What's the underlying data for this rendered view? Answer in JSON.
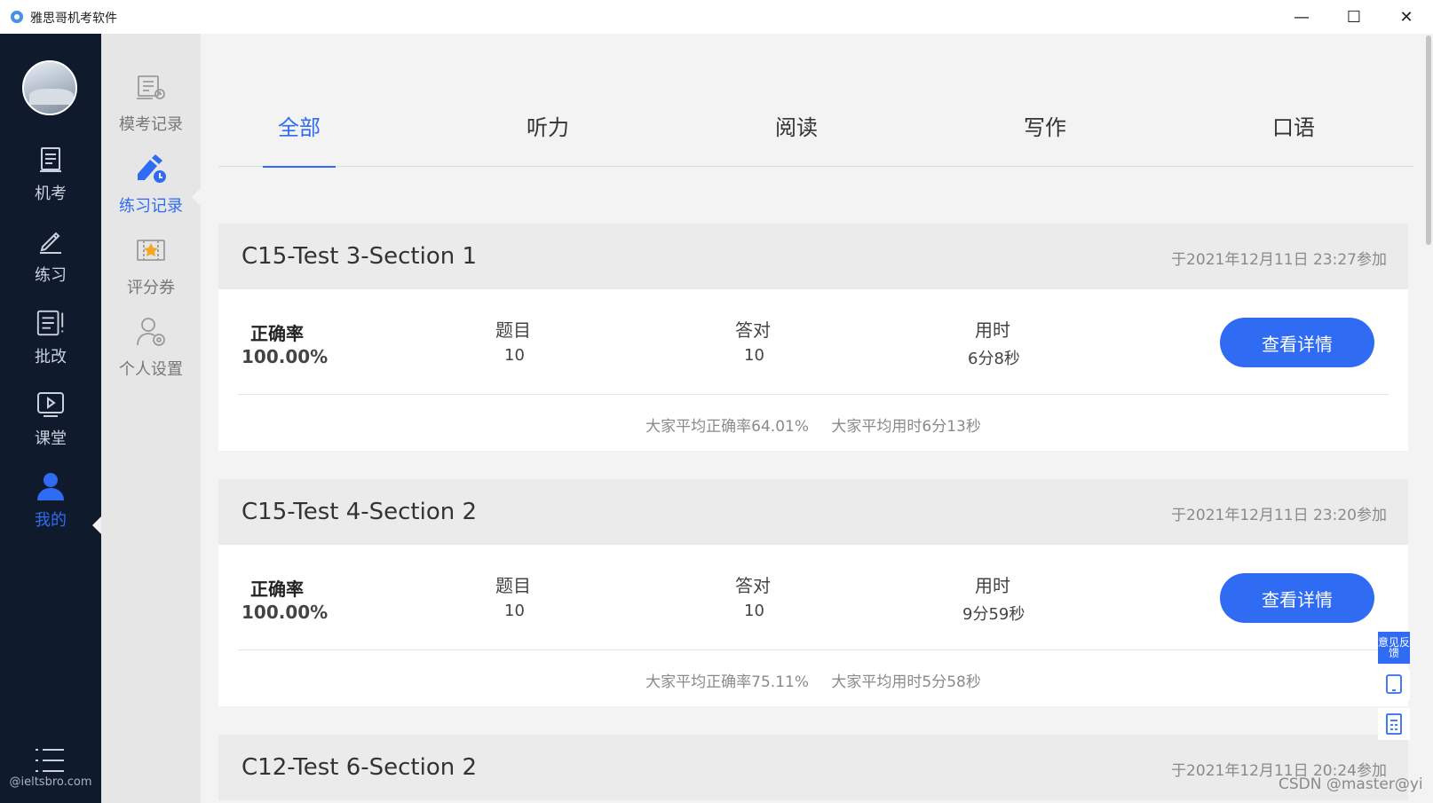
{
  "window": {
    "title": "雅思哥机考软件",
    "controls": {
      "minimize": "—",
      "maximize": "☐",
      "close": "✕"
    }
  },
  "nav": {
    "items": [
      {
        "label": "机考",
        "icon": "exam-icon"
      },
      {
        "label": "练习",
        "icon": "pencil-icon"
      },
      {
        "label": "批改",
        "icon": "correction-icon"
      },
      {
        "label": "课堂",
        "icon": "video-icon"
      },
      {
        "label": "我的",
        "icon": "user-icon",
        "active": true
      }
    ],
    "menu_icon": "menu-icon",
    "footer": "@ieltsbro.com"
  },
  "subnav": {
    "items": [
      {
        "label": "模考记录",
        "icon": "mock-record-icon"
      },
      {
        "label": "练习记录",
        "icon": "practice-record-icon",
        "active": true
      },
      {
        "label": "评分券",
        "icon": "coupon-icon"
      },
      {
        "label": "个人设置",
        "icon": "settings-user-icon"
      }
    ]
  },
  "tabs": [
    {
      "label": "全部",
      "active": true
    },
    {
      "label": "听力"
    },
    {
      "label": "阅读"
    },
    {
      "label": "写作"
    },
    {
      "label": "口语"
    }
  ],
  "labels": {
    "accuracy": "正确率",
    "questions": "题目",
    "correct": "答对",
    "time_used": "用时",
    "detail_button": "查看详情"
  },
  "records": [
    {
      "title": "C15-Test 3-Section 1",
      "date": "于2021年12月11日 23:27参加",
      "accuracy": "100.00%",
      "questions": "10",
      "correct": "10",
      "time_used": "6分8秒",
      "avg_accuracy": "大家平均正确率64.01%",
      "avg_time": "大家平均用时6分13秒"
    },
    {
      "title": "C15-Test 4-Section 2",
      "date": "于2021年12月11日 23:20参加",
      "accuracy": "100.00%",
      "questions": "10",
      "correct": "10",
      "time_used": "9分59秒",
      "avg_accuracy": "大家平均正确率75.11%",
      "avg_time": "大家平均用时5分58秒"
    },
    {
      "title": "C12-Test 6-Section 2",
      "date": "于2021年12月11日 20:24参加"
    }
  ],
  "floating": {
    "feedback": "意见反馈",
    "icons": [
      "tablet-icon",
      "document-icon"
    ]
  },
  "watermark": "CSDN @master@yi",
  "colors": {
    "accent": "#2f6bf3",
    "nav_bg": "#0f1b2c",
    "subnav_bg": "#e6e6e6",
    "main_bg": "#f3f3f3"
  }
}
